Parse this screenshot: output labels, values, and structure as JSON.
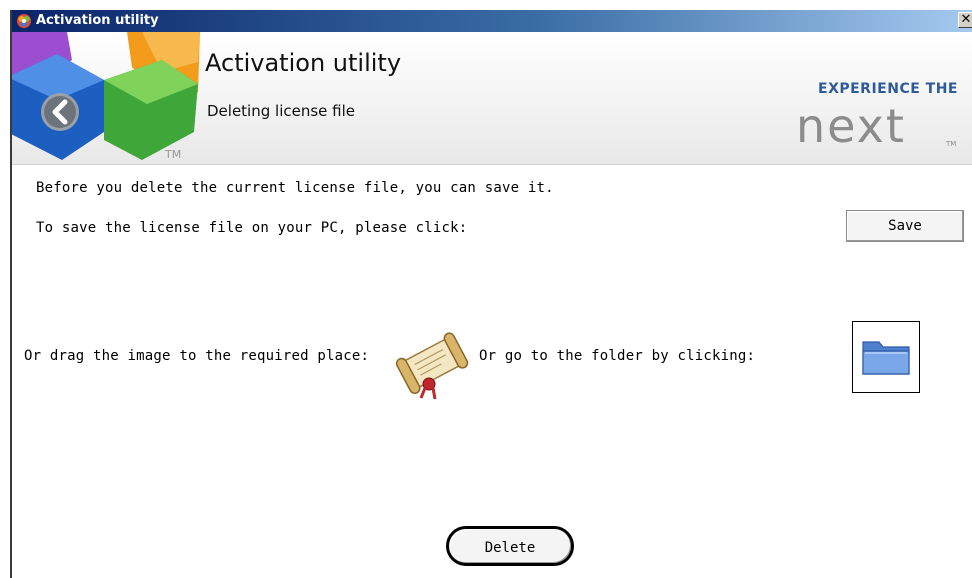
{
  "window": {
    "title": "Activation utility",
    "close_glyph": "✕"
  },
  "header": {
    "title": "Activation utility",
    "subtitle": "Deleting license file",
    "tm": "TM",
    "brand_tagline": "EXPERIENCE THE",
    "brand_word": "next"
  },
  "content": {
    "line1": "Before you delete the current license file, you can save it.",
    "line2": "To save the license file on your PC, please click:",
    "save_label": "Save",
    "drag_text": "Or drag the image to the required place:",
    "folder_text": "Or go to the folder by clicking:",
    "delete_label": "Delete"
  },
  "icons": {
    "app": "app-logo-icon",
    "back": "back-arrow-icon",
    "license": "license-scroll-icon",
    "folder": "folder-icon"
  },
  "colors": {
    "titlebar_start": "#0a246a",
    "titlebar_end": "#a6caf0",
    "brand": "#2d5a9a",
    "folder": "#6f9be0"
  }
}
